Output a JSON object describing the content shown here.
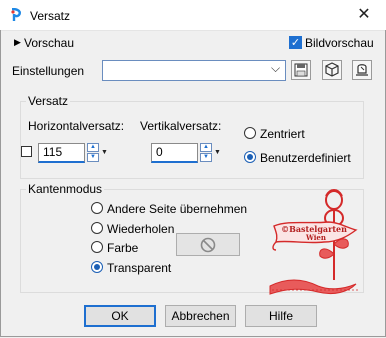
{
  "window": {
    "title": "Versatz",
    "close_glyph": "✕"
  },
  "preview": {
    "label": "Vorschau",
    "chevron": "▶"
  },
  "bildvorschau": {
    "label": "Bildvorschau",
    "checked": true
  },
  "settings": {
    "label": "Einstellungen",
    "value": "",
    "chevron": "⌵"
  },
  "toolbar": {
    "save_icon": "save-icon",
    "reset_icon": "cube-icon",
    "delete_icon": "delete-preset-icon"
  },
  "offset": {
    "group_label": "Versatz",
    "horizontal_label": "Horizontalversatz:",
    "horizontal_value": "115",
    "vertical_label": "Vertikalversatz:",
    "vertical_value": "0",
    "centered_label": "Zentriert",
    "custom_label": "Benutzerdefiniert",
    "selected": "custom"
  },
  "edge_mode": {
    "group_label": "Kantenmodus",
    "options": [
      "Andere Seite übernehmen",
      "Wiederholen",
      "Farbe",
      "Transparent"
    ],
    "selected": "Transparent"
  },
  "watermark": {
    "line1": "©Bastelgarten",
    "line2": "Wien",
    "color": "#d42a2a"
  },
  "buttons": {
    "ok": "OK",
    "cancel": "Abbrechen",
    "help": "Hilfe"
  },
  "colors": {
    "accent": "#1e6fd0",
    "background": "#f0f0f0"
  }
}
